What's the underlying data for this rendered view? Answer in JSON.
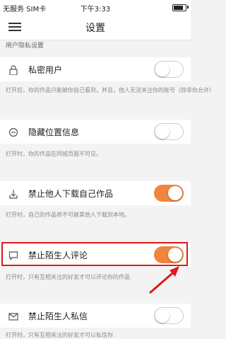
{
  "status_bar": {
    "carrier": "无服务 SIM卡",
    "time": "下午3:33"
  },
  "header": {
    "title": "设置"
  },
  "section": {
    "title": "用户隐私设置"
  },
  "settings": [
    {
      "label": "私密用户",
      "description": "打开后，你的作品只能被你自己看到，并且，他人无法关注你的账号（除非你允许）",
      "enabled": false,
      "icon": "lock-icon"
    },
    {
      "label": "隐藏位置信息",
      "description": "打开时，你的作品在同城页面不可见。",
      "enabled": false,
      "icon": "location-pin-icon"
    },
    {
      "label": "禁止他人下载自己作品",
      "description": "打开时，自己的作品将不可被其他人下载到本地。",
      "enabled": true,
      "icon": "download-icon"
    },
    {
      "label": "禁止陌生人评论",
      "description": "打开时，只有互相关注的好友才可以评论你的作品",
      "enabled": true,
      "icon": "comment-icon"
    },
    {
      "label": "禁止陌生人私信",
      "description": "打开时，只有互相关注的好友才可以私信你",
      "enabled": false,
      "icon": "mail-icon"
    }
  ],
  "accent_color": "#f2843d",
  "highlight_color": "#e01818"
}
